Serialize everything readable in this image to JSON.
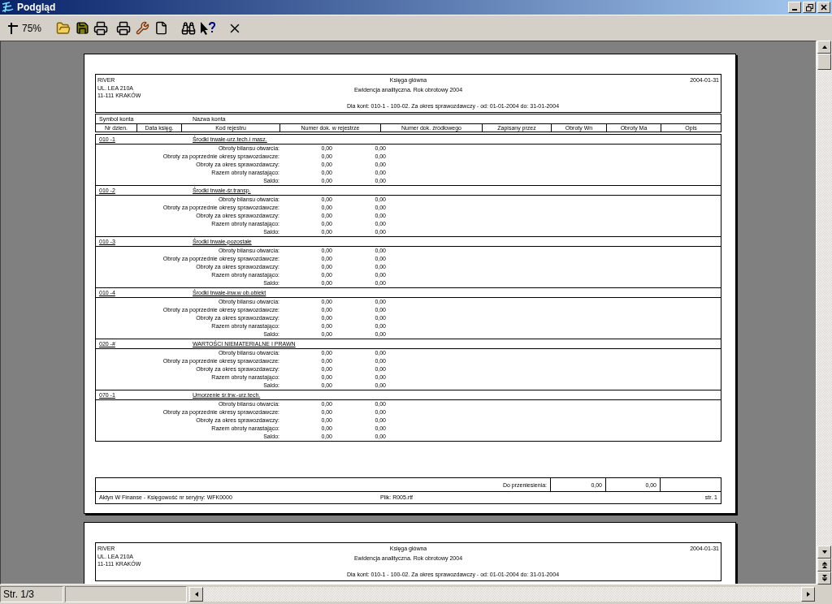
{
  "window": {
    "title": "Podgląd"
  },
  "toolbar": {
    "zoom": "75%"
  },
  "pages": [
    {
      "header": {
        "company": [
          "RIVER",
          "UL. LEA 210A",
          "11-111 KRAKÓW"
        ],
        "title": "Księga główna",
        "subtitle": "Ewidencja analityczna. Rok obrotowy 2004",
        "range": "Dla kont: 010-1 - 100-02.  Za okres sprawozdawczy - od: 01-01-2004 do: 31-01-2004",
        "date": "2004-01-31"
      },
      "column_header": {
        "top": [
          "Symbol konta",
          "Nazwa konta"
        ],
        "columns": [
          "Nr dzien.",
          "Data księg.",
          "Kod rejestru",
          "Numer dok. w rejestrze",
          "Numer dok. źródłowego",
          "Zapisany przez",
          "Obroty Wn",
          "Obroty Ma",
          "Opis"
        ]
      },
      "sections": [
        {
          "code": "010 -1",
          "name": "Środki trwałe-urz.tech.i masz.",
          "rows": [
            {
              "label": "Obroty bilansu otwarcia:",
              "wn": "0,00",
              "ma": "0,00"
            },
            {
              "label": "Obroty za poprzednie okresy sprawozdawcze:",
              "wn": "0,00",
              "ma": "0,00"
            },
            {
              "label": "Obroty za okres sprawozdawczy:",
              "wn": "0,00",
              "ma": "0,00"
            },
            {
              "label": "Razem obroty narastająco:",
              "wn": "0,00",
              "ma": "0,00"
            },
            {
              "label": "Saldo:",
              "wn": "0,00",
              "ma": "0,00"
            }
          ]
        },
        {
          "code": "010 -2",
          "name": "Środki trwałe-śr.transp.",
          "rows": [
            {
              "label": "Obroty bilansu otwarcia:",
              "wn": "0,00",
              "ma": "0,00"
            },
            {
              "label": "Obroty za poprzednie okresy sprawozdawcze:",
              "wn": "0,00",
              "ma": "0,00"
            },
            {
              "label": "Obroty za okres sprawozdawczy:",
              "wn": "0,00",
              "ma": "0,00"
            },
            {
              "label": "Razem obroty narastająco:",
              "wn": "0,00",
              "ma": "0,00"
            },
            {
              "label": "Saldo:",
              "wn": "0,00",
              "ma": "0,00"
            }
          ]
        },
        {
          "code": "010 -3",
          "name": "Środki trwałe-pozostałe",
          "rows": [
            {
              "label": "Obroty bilansu otwarcia:",
              "wn": "0,00",
              "ma": "0,00"
            },
            {
              "label": "Obroty za poprzednie okresy sprawozdawcze:",
              "wn": "0,00",
              "ma": "0,00"
            },
            {
              "label": "Obroty za okres sprawozdawczy:",
              "wn": "0,00",
              "ma": "0,00"
            },
            {
              "label": "Razem obroty narastająco:",
              "wn": "0,00",
              "ma": "0,00"
            },
            {
              "label": "Saldo:",
              "wn": "0,00",
              "ma": "0,00"
            }
          ]
        },
        {
          "code": "010 -4",
          "name": "Środki trwałe-inw.w ob.obiekt",
          "rows": [
            {
              "label": "Obroty bilansu otwarcia:",
              "wn": "0,00",
              "ma": "0,00"
            },
            {
              "label": "Obroty za poprzednie okresy sprawozdawcze:",
              "wn": "0,00",
              "ma": "0,00"
            },
            {
              "label": "Obroty za okres sprawozdawczy:",
              "wn": "0,00",
              "ma": "0,00"
            },
            {
              "label": "Razem obroty narastająco:",
              "wn": "0,00",
              "ma": "0,00"
            },
            {
              "label": "Saldo:",
              "wn": "0,00",
              "ma": "0,00"
            }
          ]
        },
        {
          "code": "020 -#",
          "name": "WARTOŚCI NIEMATERIALNE I PRAWN",
          "rows": [
            {
              "label": "Obroty bilansu otwarcia:",
              "wn": "0,00",
              "ma": "0,00"
            },
            {
              "label": "Obroty za poprzednie okresy sprawozdawcze:",
              "wn": "0,00",
              "ma": "0,00"
            },
            {
              "label": "Obroty za okres sprawozdawczy:",
              "wn": "0,00",
              "ma": "0,00"
            },
            {
              "label": "Razem obroty narastająco:",
              "wn": "0,00",
              "ma": "0,00"
            },
            {
              "label": "Saldo:",
              "wn": "0,00",
              "ma": "0,00"
            }
          ]
        },
        {
          "code": "070 -1",
          "name": "Umorzenie śr.trw.-urz.tech.",
          "rows": [
            {
              "label": "Obroty bilansu otwarcia:",
              "wn": "0,00",
              "ma": "0,00"
            },
            {
              "label": "Obroty za poprzednie okresy sprawozdawcze:",
              "wn": "0,00",
              "ma": "0,00"
            },
            {
              "label": "Obroty za okres sprawozdawczy:",
              "wn": "0,00",
              "ma": "0,00"
            },
            {
              "label": "Razem obroty narastająco:",
              "wn": "0,00",
              "ma": "0,00"
            },
            {
              "label": "Saldo:",
              "wn": "0,00",
              "ma": "0,00"
            }
          ]
        }
      ],
      "footer": {
        "carry_label": "Do przeniesienia:",
        "carry_wn": "0,00",
        "carry_ma": "0,00",
        "program": "Aktyn W Finanse - Księgowość nr seryjny: WFK0000",
        "file": "Plik: R005.rtf",
        "page": "str. 1"
      }
    },
    {
      "header": {
        "company": [
          "RIVER",
          "UL. LEA 210A",
          "11-111 KRAKÓW"
        ],
        "title": "Księga główna",
        "subtitle": "Ewidencja analityczna. Rok obrotowy 2004",
        "range": "Dla kont: 010-1 - 100-02.  Za okres sprawozdawczy - od: 01-01-2004 do: 31-01-2004",
        "date": "2004-01-31"
      }
    }
  ],
  "status_bar": {
    "page": "Str. 1/3"
  }
}
